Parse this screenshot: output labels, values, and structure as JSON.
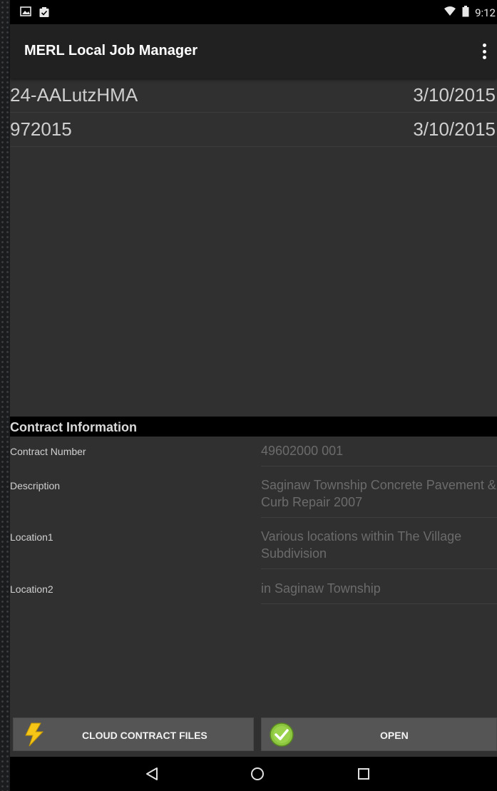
{
  "status_bar": {
    "time": "9:12",
    "icons": [
      "image-icon",
      "clipboard-icon",
      "wifi-icon",
      "battery-icon"
    ]
  },
  "app": {
    "title": "MERL Local Job Manager",
    "menu_icon": "overflow-menu-icon"
  },
  "jobs": [
    {
      "name": "24-AALutzHMA",
      "date": "3/10/2015"
    },
    {
      "name": "972015",
      "date": "3/10/2015"
    }
  ],
  "contract_info": {
    "header": "Contract Information",
    "rows": [
      {
        "label": "Contract Number",
        "value": "49602000 001"
      },
      {
        "label": "Description",
        "value": "Saginaw Township Concrete Pavement & Curb Repair 2007"
      },
      {
        "label": "Location1",
        "value": "Various locations within The Village Subdivision"
      },
      {
        "label": "Location2",
        "value": "in Saginaw Township"
      }
    ]
  },
  "buttons": {
    "cloud_label": "CLOUD CONTRACT FILES",
    "cloud_icon": "lightning-bolt-icon",
    "open_label": "OPEN",
    "open_icon": "green-check-icon"
  },
  "nav": {
    "icons": [
      "back-icon",
      "home-icon",
      "recents-icon"
    ]
  },
  "colors": {
    "background": "#303030",
    "action_bar": "#212121",
    "button": "#555555",
    "value_text": "#6b6b6b",
    "check_green": "#8cc63f",
    "bolt_yellow": "#f5c518"
  }
}
